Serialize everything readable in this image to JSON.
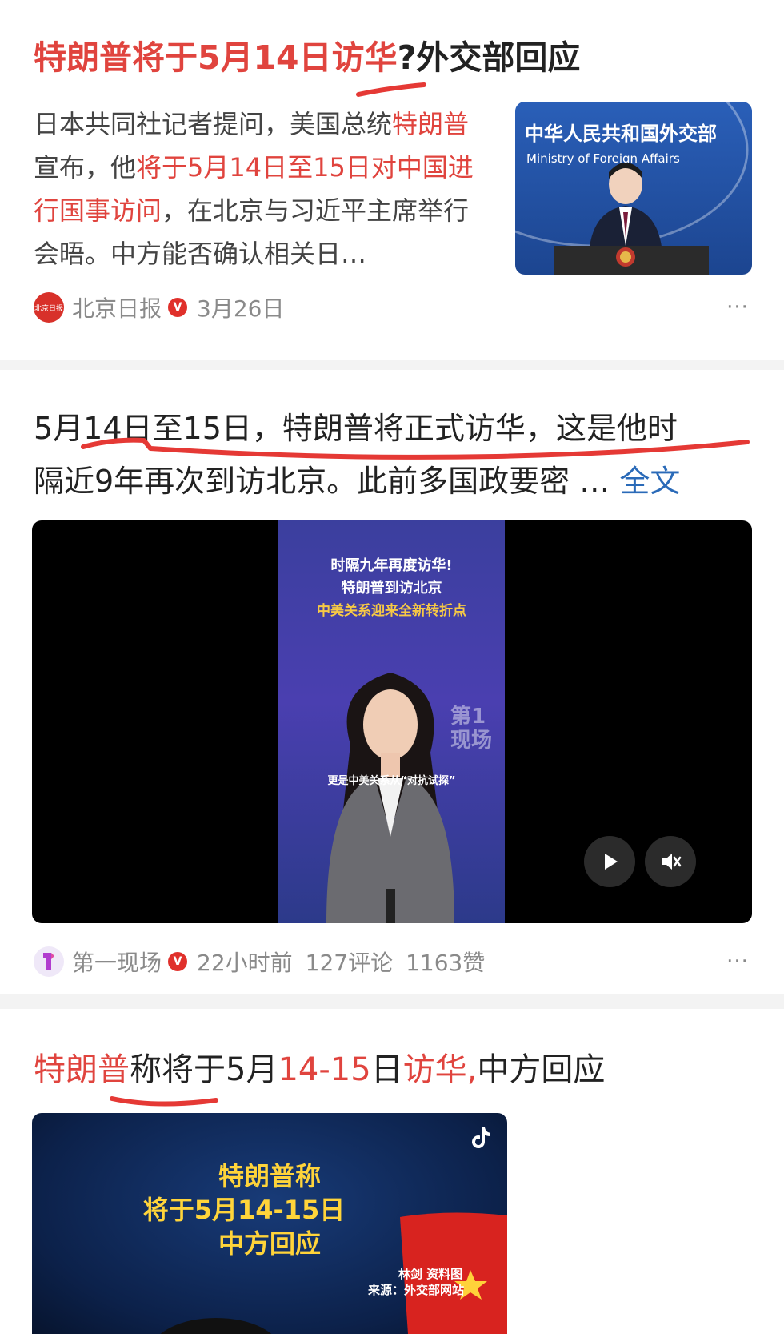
{
  "card1": {
    "title_parts": [
      "特朗普将于5月14日访华",
      "?外交部回应"
    ],
    "snippet_parts": [
      "日本共同社记者提问，美国总统",
      "特朗普",
      "宣布，他",
      "将于5月14日至15日对中国进行国事访问",
      "，在北京与习近平主席举行会晤。中方能否确认相关日…"
    ],
    "thumb_text_cn": "中华人民共和国外交部",
    "thumb_text_en": "Ministry of Foreign Affairs",
    "source": "北京日报",
    "source_avatar_text": "北京日报",
    "verified": "V",
    "date": "3月26日",
    "more": "···"
  },
  "card2": {
    "text_line1": "5月14日至15日，特朗普将正式访华，这是他时",
    "text_line2": "隔近9年再次到访北京。此前多国政要密 …",
    "full_text_link": "全文",
    "video_caption1": "时隔九年再度访华!",
    "video_caption2": "特朗普到访北京",
    "video_caption3": "中美关系迎来全新转折点",
    "video_watermark": "第1现场",
    "video_subtitle": "更是中美关系从“对抗试探”",
    "source": "第一现场",
    "verified": "V",
    "time": "22小时前",
    "comments": "127评论",
    "likes": "1163赞",
    "more": "···"
  },
  "card3": {
    "title_parts": [
      "特朗普",
      "称将于5月",
      "14-15",
      "日",
      "访华,",
      "中方回应"
    ],
    "thumb_line1": "特朗普称",
    "thumb_line2": "将于5月14-15日",
    "thumb_line3": "中方回应",
    "thumb_credit1": "林剑 资料图",
    "thumb_credit2": "来源：外交部网站"
  },
  "colors": {
    "highlight": "#e0443e",
    "link": "#2a6ab8",
    "annotation": "#e53935",
    "separator": "#f3f3f3"
  }
}
